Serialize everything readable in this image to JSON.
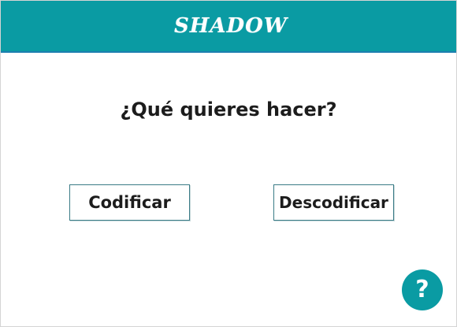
{
  "app": {
    "title": "SHADOW"
  },
  "main": {
    "question": "¿Qué quieres hacer?",
    "encode_label": "Codificar",
    "decode_label": "Descodificar"
  },
  "help": {
    "glyph": "?",
    "icon": "question-mark-icon"
  },
  "colors": {
    "accent": "#0a9ba3",
    "button_border": "#3a7b86",
    "text": "#1c1c1c",
    "background": "#ffffff"
  }
}
